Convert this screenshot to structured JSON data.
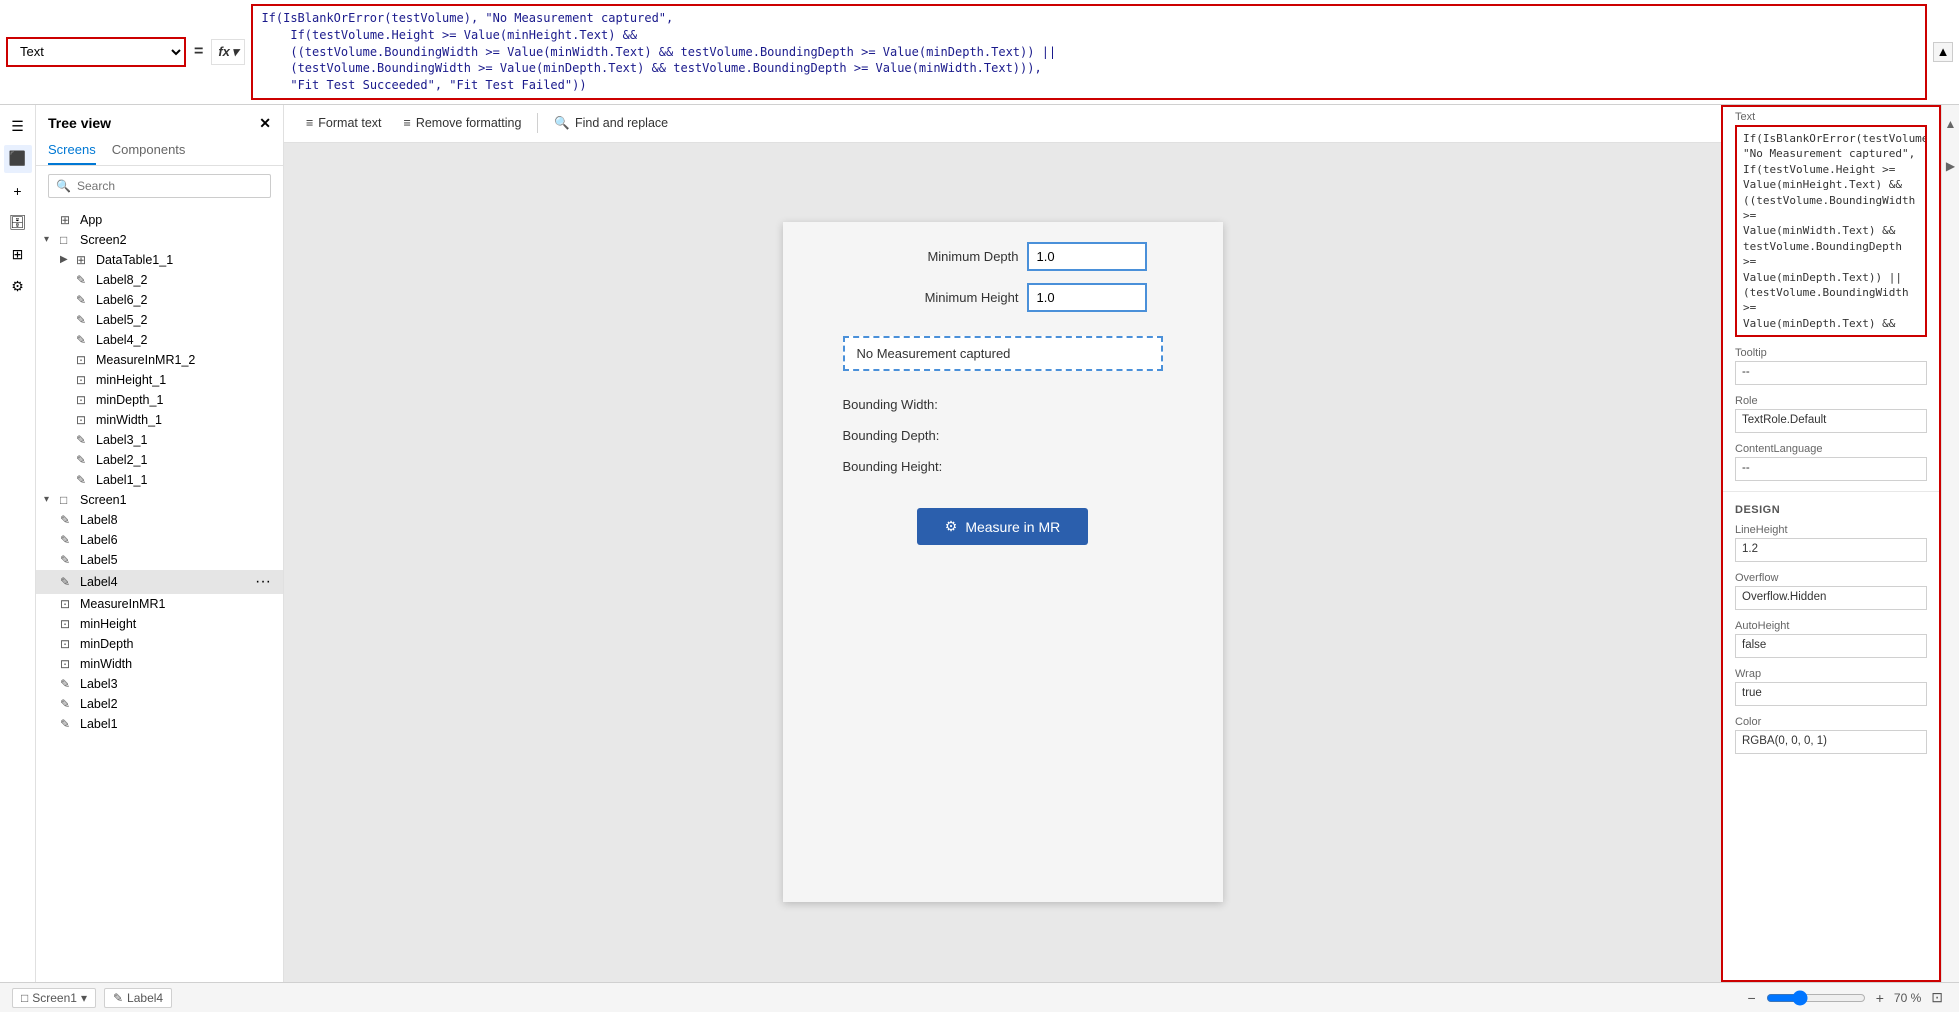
{
  "formulaBar": {
    "selector": "Text",
    "equals": "=",
    "fx": "fx",
    "formula": "If(IsBlankOrError(testVolume), \"No Measurement captured\",\n    If(testVolume.Height >= Value(minHeight.Text) &&\n    ((testVolume.BoundingWidth >= Value(minWidth.Text) && testVolume.BoundingDepth >= Value(minDepth.Text)) ||\n    (testVolume.BoundingWidth >= Value(minDepth.Text) && testVolume.BoundingDepth >= Value(minWidth.Text))),\n    \"Fit Test Succeeded\", \"Fit Test Failed\"))"
  },
  "sidebar": {
    "icons": [
      "≡",
      "⬛",
      "+",
      "📋",
      "⊞",
      "⚙"
    ]
  },
  "treePanel": {
    "title": "Tree view",
    "tabs": [
      "Screens",
      "Components"
    ],
    "activeTab": "Screens",
    "searchPlaceholder": "Search",
    "items": [
      {
        "label": "App",
        "indent": 0,
        "type": "app",
        "expanded": false
      },
      {
        "label": "Screen2",
        "indent": 0,
        "type": "screen",
        "expanded": true
      },
      {
        "label": "DataTable1_1",
        "indent": 1,
        "type": "table",
        "expanded": false
      },
      {
        "label": "Label8_2",
        "indent": 2,
        "type": "label",
        "expanded": false
      },
      {
        "label": "Label6_2",
        "indent": 2,
        "type": "label",
        "expanded": false
      },
      {
        "label": "Label5_2",
        "indent": 2,
        "type": "label",
        "expanded": false
      },
      {
        "label": "Label4_2",
        "indent": 2,
        "type": "label",
        "expanded": false
      },
      {
        "label": "MeasureInMR1_2",
        "indent": 2,
        "type": "measure",
        "expanded": false
      },
      {
        "label": "minHeight_1",
        "indent": 2,
        "type": "input",
        "expanded": false
      },
      {
        "label": "minDepth_1",
        "indent": 2,
        "type": "input",
        "expanded": false
      },
      {
        "label": "minWidth_1",
        "indent": 2,
        "type": "input",
        "expanded": false
      },
      {
        "label": "Label3_1",
        "indent": 2,
        "type": "label",
        "expanded": false
      },
      {
        "label": "Label2_1",
        "indent": 2,
        "type": "label",
        "expanded": false
      },
      {
        "label": "Label1_1",
        "indent": 2,
        "type": "label",
        "expanded": false
      },
      {
        "label": "Screen1",
        "indent": 0,
        "type": "screen",
        "expanded": true
      },
      {
        "label": "Label8",
        "indent": 1,
        "type": "label",
        "expanded": false
      },
      {
        "label": "Label6",
        "indent": 1,
        "type": "label",
        "expanded": false
      },
      {
        "label": "Label5",
        "indent": 1,
        "type": "label",
        "expanded": false
      },
      {
        "label": "Label4",
        "indent": 1,
        "type": "label",
        "expanded": false,
        "selected": true
      },
      {
        "label": "MeasureInMR1",
        "indent": 1,
        "type": "measure",
        "expanded": false
      },
      {
        "label": "minHeight",
        "indent": 1,
        "type": "input",
        "expanded": false
      },
      {
        "label": "minDepth",
        "indent": 1,
        "type": "input",
        "expanded": false
      },
      {
        "label": "minWidth",
        "indent": 1,
        "type": "input",
        "expanded": false
      },
      {
        "label": "Label3",
        "indent": 1,
        "type": "label",
        "expanded": false
      },
      {
        "label": "Label2",
        "indent": 1,
        "type": "label",
        "expanded": false
      },
      {
        "label": "Label1",
        "indent": 1,
        "type": "label",
        "expanded": false
      }
    ]
  },
  "toolbar": {
    "formatText": "Format text",
    "removeFormatting": "Remove formatting",
    "findAndReplace": "Find and replace"
  },
  "canvas": {
    "form": {
      "rows": [
        {
          "label": "Minimum Depth",
          "value": "1.0"
        },
        {
          "label": "Minimum Height",
          "value": "1.0"
        }
      ],
      "selectedLabel": "No Measurement captured",
      "fields": [
        "Bounding Width:",
        "Bounding Depth:",
        "Bounding Height:"
      ],
      "measureButton": "Measure in MR"
    }
  },
  "propsPanel": {
    "textLabel": "Text",
    "textFormula": "If(IsBlankOrError(testVolume), \"No Measurement captured\",\nIf(testVolume.Height >=\nValue(minHeight.Text) &&\n((testVolume.BoundingWidth >=\nValue(minWidth.Text) &&\ntestVolume.BoundingDepth >=\nValue(minDepth.Text)) ||\n(testVolume.BoundingWidth >=\nValue(minDepth.Text) &&",
    "tooltipLabel": "Tooltip",
    "tooltipValue": "--",
    "roleLabel": "Role",
    "roleValue": "TextRole.Default",
    "contentLanguageLabel": "ContentLanguage",
    "contentLanguageValue": "--",
    "designLabel": "DESIGN",
    "lineHeightLabel": "LineHeight",
    "lineHeightValue": "1.2",
    "overflowLabel": "Overflow",
    "overflowValue": "Overflow.Hidden",
    "autoHeightLabel": "AutoHeight",
    "autoHeightValue": "false",
    "wrapLabel": "Wrap",
    "wrapValue": "true",
    "colorLabel": "Color",
    "colorValue": "RGBA(0, 0, 0, 1)"
  },
  "statusBar": {
    "screen": "Screen1",
    "element": "Label4",
    "zoomMinus": "−",
    "zoomPercent": "70 %",
    "zoomPlus": "+"
  }
}
